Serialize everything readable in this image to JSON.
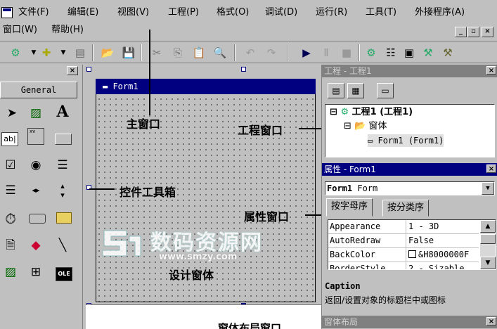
{
  "menubar": {
    "row1": [
      "文件(F)",
      "编辑(E)",
      "视图(V)",
      "工程(P)",
      "格式(O)",
      "调试(D)",
      "运行(R)",
      "工具(T)",
      "外接程序(A)"
    ],
    "row2": [
      "窗口(W)",
      "帮助(H)"
    ],
    "mdi_buttons": [
      "_",
      "▫",
      "×"
    ]
  },
  "toolbar": {
    "icons": [
      "add-project-icon",
      "add-form-icon",
      "menu-editor-icon",
      "open-icon",
      "save-icon",
      "cut-icon",
      "copy-icon",
      "paste-icon",
      "find-icon",
      "undo-icon",
      "redo-icon",
      "run-icon",
      "pause-icon",
      "stop-icon",
      "project-explorer-icon",
      "properties-icon",
      "form-layout-icon",
      "object-browser-icon",
      "toolbox-icon"
    ]
  },
  "toolbox": {
    "tab_label": "General",
    "tools": [
      "pointer",
      "picturebox",
      "label",
      "textbox",
      "frame",
      "commandbutton",
      "checkbox",
      "optionbutton",
      "combobox",
      "listbox",
      "hscrollbar",
      "vscrollbar",
      "timer",
      "drivelistbox",
      "dirlistbox",
      "filelistbox",
      "shape",
      "line",
      "image",
      "data",
      "ole"
    ],
    "textbox_glyph": "ab|",
    "frame_glyph": "xv",
    "ole_glyph": "OLE",
    "label_glyph": "A"
  },
  "form": {
    "title": "Form1"
  },
  "annotations": {
    "main_window": "主窗口",
    "project_window": "工程窗口",
    "toolbox": "控件工具箱",
    "properties_window": "属性窗口",
    "design_form": "设计窗体",
    "form_layout_window": "窗体布局窗口"
  },
  "project_panel": {
    "title": "工程 - 工程1",
    "tree": {
      "root": "工程1 (工程1)",
      "folder": "窗体",
      "leaf": "Form1 (Form1)"
    }
  },
  "properties_panel": {
    "title": "属性 - Form1",
    "object_name": "Form1",
    "object_type": "Form",
    "tabs": [
      "按字母序",
      "按分类序"
    ],
    "rows": [
      {
        "name": "Appearance",
        "value": "1 - 3D"
      },
      {
        "name": "AutoRedraw",
        "value": "False"
      },
      {
        "name": "BackColor",
        "value": "&H8000000F"
      },
      {
        "name": "BorderStyle",
        "value": "2 - Sizable"
      }
    ],
    "desc_title": "Caption",
    "desc_text": "返回/设置对象的标题栏中或图标"
  },
  "layout_panel": {
    "title": "窗体布局"
  },
  "watermark": {
    "text": "数码资源网",
    "url": "www.smzy.com"
  }
}
